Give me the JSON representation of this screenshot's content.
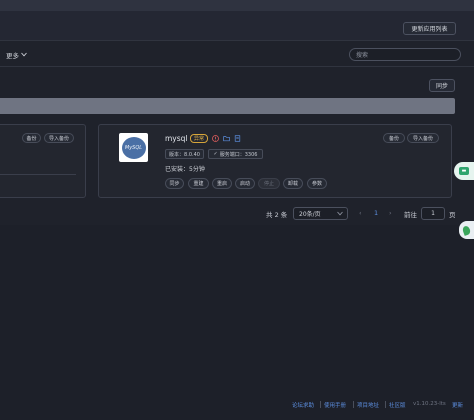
{
  "header": {
    "update_app_list": "更新应用列表"
  },
  "filter": {
    "more_label": "更多",
    "search_placeholder": "搜索"
  },
  "toolbar": {
    "sync_label": "同步"
  },
  "left_card": {
    "backup": "备份",
    "import_backup": "导入备份"
  },
  "app": {
    "name": "mysql",
    "status": "异常",
    "logo_text": "MySQL",
    "version": "版本：8.0.40",
    "port": "服务端口：3306",
    "installed": "已安装：5分钟",
    "backup": "备份",
    "import_backup": "导入备份",
    "actions": [
      {
        "label": "同步",
        "disabled": false
      },
      {
        "label": "重建",
        "disabled": false
      },
      {
        "label": "重启",
        "disabled": false
      },
      {
        "label": "启动",
        "disabled": false
      },
      {
        "label": "停止",
        "disabled": true
      },
      {
        "label": "卸载",
        "disabled": false
      },
      {
        "label": "参数",
        "disabled": false
      }
    ]
  },
  "pagination": {
    "total": "共 2 条",
    "page_size": "20条/页",
    "current_page": "1",
    "goto_label": "前往",
    "goto_value": "1",
    "page_suffix": "页"
  },
  "footer": {
    "links": [
      "论坛求助",
      "使用手册",
      "项目地址",
      "社区版"
    ],
    "version": "v1.10.23-lts",
    "upgrade": "更新"
  },
  "colors": {
    "accent": "#5d8fe0",
    "warning": "#e2b44a",
    "danger": "#e05d5d"
  }
}
